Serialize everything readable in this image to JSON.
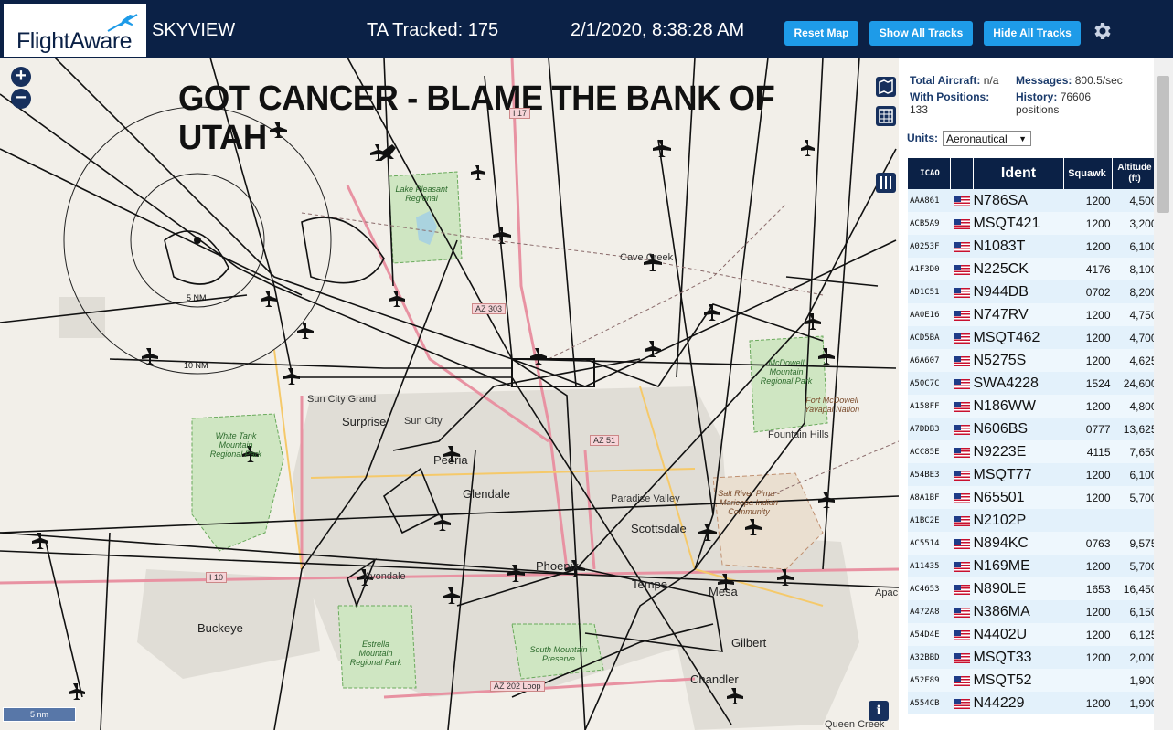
{
  "header": {
    "logo": "FlightAware",
    "app_name": "SKYVIEW",
    "tracked": "TA Tracked: 175",
    "datetime": "2/1/2020, 8:38:28 AM",
    "buttons": {
      "reset": "Reset Map",
      "show_all": "Show All Tracks",
      "hide_all": "Hide All Tracks"
    }
  },
  "map": {
    "banner": "GOT CANCER - BLAME THE BANK OF UTAH",
    "zoom_in": "+",
    "zoom_out": "−",
    "ring_labels": {
      "inner": "5 NM",
      "outer": "10 NM"
    },
    "scale": "5 nm",
    "info": "i",
    "places": {
      "sun_city_grand": "Sun City Grand",
      "surprise": "Surprise",
      "sun_city": "Sun City",
      "peoria": "Peoria",
      "glendale": "Glendale",
      "paradise_valley": "Paradise Valley",
      "scottsdale": "Scottsdale",
      "phoenix": "Phoenix",
      "tempe": "Tempe",
      "mesa": "Mesa",
      "gilbert": "Gilbert",
      "chandler": "Chandler",
      "buckeye": "Buckeye",
      "avondale": "Avondale",
      "fountain_hills": "Fountain Hills",
      "cave_creek": "Cave Creek",
      "queen_creek": "Queen Creek",
      "apache": "Apac"
    },
    "parks": {
      "white_tank": "White Tank Mountain Regional Park",
      "estrella": "Estrella Mountain Regional Park",
      "south_mountain": "South Mountain Preserve",
      "mcdowell": "McDowell Mountain Regional Park",
      "salt_river": "Salt River Pima - Maricopa Indian Community",
      "lake_pleasant": "Lake Pleasant Regional",
      "fort_mcdowell": "Fort McDowell Yavapai Nation"
    },
    "highways": {
      "i17": "I 17",
      "az303": "AZ 303",
      "az51": "AZ 51",
      "i10": "I 10",
      "az202": "AZ 202 Loop"
    }
  },
  "sidebar": {
    "total_label": "Total Aircraft:",
    "total_value": "n/a",
    "messages_label": "Messages:",
    "messages_value": "800.5/sec",
    "positions_label": "With Positions:",
    "positions_value": "133",
    "history_label": "History:",
    "history_value": "76606 positions",
    "units_label": "Units:",
    "units_value": "Aeronautical",
    "columns": {
      "icao": "ICAO",
      "flag": "",
      "ident": "Ident",
      "squawk": "Squawk",
      "altitude": "Altitude (ft)"
    },
    "rows": [
      {
        "icao": "AAA861",
        "ident": "N786SA",
        "squawk": "1200",
        "alt": "4,500"
      },
      {
        "icao": "ACB5A9",
        "ident": "MSQT421",
        "squawk": "1200",
        "alt": "3,200"
      },
      {
        "icao": "A0253F",
        "ident": "N1083T",
        "squawk": "1200",
        "alt": "6,100"
      },
      {
        "icao": "A1F3D0",
        "ident": "N225CK",
        "squawk": "4176",
        "alt": "8,100"
      },
      {
        "icao": "AD1C51",
        "ident": "N944DB",
        "squawk": "0702",
        "alt": "8,200"
      },
      {
        "icao": "AA0E16",
        "ident": "N747RV",
        "squawk": "1200",
        "alt": "4,750"
      },
      {
        "icao": "ACD5BA",
        "ident": "MSQT462",
        "squawk": "1200",
        "alt": "4,700"
      },
      {
        "icao": "A6A607",
        "ident": "N5275S",
        "squawk": "1200",
        "alt": "4,625"
      },
      {
        "icao": "A50C7C",
        "ident": "SWA4228",
        "squawk": "1524",
        "alt": "24,600"
      },
      {
        "icao": "A158FF",
        "ident": "N186WW",
        "squawk": "1200",
        "alt": "4,800"
      },
      {
        "icao": "A7DDB3",
        "ident": "N606BS",
        "squawk": "0777",
        "alt": "13,625"
      },
      {
        "icao": "ACC85E",
        "ident": "N9223E",
        "squawk": "4115",
        "alt": "7,650"
      },
      {
        "icao": "A54BE3",
        "ident": "MSQT77",
        "squawk": "1200",
        "alt": "6,100"
      },
      {
        "icao": "A8A1BF",
        "ident": "N65501",
        "squawk": "1200",
        "alt": "5,700"
      },
      {
        "icao": "A1BC2E",
        "ident": "N2102P",
        "squawk": "",
        "alt": ""
      },
      {
        "icao": "AC5514",
        "ident": "N894KC",
        "squawk": "0763",
        "alt": "9,575"
      },
      {
        "icao": "A11435",
        "ident": "N169ME",
        "squawk": "1200",
        "alt": "5,700"
      },
      {
        "icao": "AC4653",
        "ident": "N890LE",
        "squawk": "1653",
        "alt": "16,450"
      },
      {
        "icao": "A472A8",
        "ident": "N386MA",
        "squawk": "1200",
        "alt": "6,150"
      },
      {
        "icao": "A54D4E",
        "ident": "N4402U",
        "squawk": "1200",
        "alt": "6,125"
      },
      {
        "icao": "A32BBD",
        "ident": "MSQT33",
        "squawk": "1200",
        "alt": "2,000"
      },
      {
        "icao": "A52F89",
        "ident": "MSQT52",
        "squawk": "",
        "alt": "1,900"
      },
      {
        "icao": "A554CB",
        "ident": "N44229",
        "squawk": "1200",
        "alt": "1,900"
      }
    ]
  },
  "colors": {
    "header_bg": "#0b2146",
    "button_bg": "#1e9be8",
    "track": "#111111",
    "park": "#cfe6c2",
    "urban": "#e0ddd6"
  }
}
